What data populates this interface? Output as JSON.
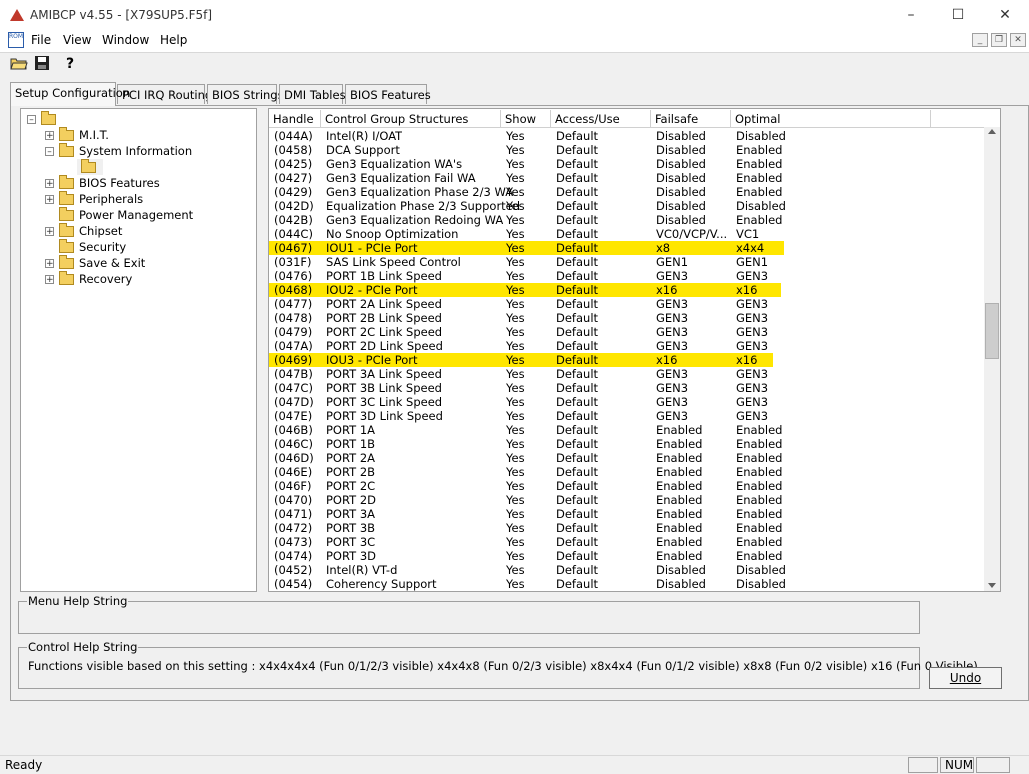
{
  "window": {
    "title": "AMIBCP v4.55 - [X79SUP5.F5f]",
    "minimize_icon": "minimize-icon",
    "maximize_icon": "maximize-icon",
    "close_icon": "close-icon"
  },
  "menu": {
    "doc_icon_text": "ROM",
    "items": [
      "File",
      "View",
      "Window",
      "Help"
    ]
  },
  "toolbar": {
    "buttons": [
      "open-folder-icon",
      "save-disk-icon",
      "help-icon"
    ]
  },
  "tabs": [
    "Setup Configuration",
    "PCI IRQ Routing",
    "BIOS Strings",
    "DMI Tables",
    "BIOS Features"
  ],
  "active_tab": "Setup Configuration",
  "tree": {
    "nodes": [
      {
        "label": "",
        "depth": 0,
        "expander": "minus"
      },
      {
        "label": "M.I.T.",
        "depth": 1,
        "expander": "plus"
      },
      {
        "label": "System Information",
        "depth": 1,
        "expander": "minus"
      },
      {
        "label": "",
        "depth": 2,
        "expander": "none",
        "selected": true
      },
      {
        "label": "BIOS Features",
        "depth": 1,
        "expander": "plus"
      },
      {
        "label": "Peripherals",
        "depth": 1,
        "expander": "plus"
      },
      {
        "label": "Power Management",
        "depth": 1,
        "expander": "none"
      },
      {
        "label": "Chipset",
        "depth": 1,
        "expander": "plus"
      },
      {
        "label": "Security",
        "depth": 1,
        "expander": "none"
      },
      {
        "label": "Save & Exit",
        "depth": 1,
        "expander": "plus"
      },
      {
        "label": "Recovery",
        "depth": 1,
        "expander": "plus"
      }
    ]
  },
  "table": {
    "columns": [
      "Handle",
      "Control Group Structures",
      "Show",
      "Access/Use",
      "Failsafe",
      "Optimal"
    ],
    "highlight_color": "#ffe600",
    "rows": [
      {
        "handle": "(044A)",
        "name": "Intel(R) I/OAT",
        "show": "Yes",
        "access": "Default",
        "failsafe": "Disabled",
        "optimal": "Disabled",
        "hl": false
      },
      {
        "handle": "(0458)",
        "name": "DCA Support",
        "show": "Yes",
        "access": "Default",
        "failsafe": "Disabled",
        "optimal": "Enabled",
        "hl": false
      },
      {
        "handle": "(0425)",
        "name": "Gen3 Equalization WA's",
        "show": "Yes",
        "access": "Default",
        "failsafe": "Disabled",
        "optimal": "Enabled",
        "hl": false
      },
      {
        "handle": "(0427)",
        "name": "Gen3 Equalization Fail WA",
        "show": "Yes",
        "access": "Default",
        "failsafe": "Disabled",
        "optimal": "Enabled",
        "hl": false
      },
      {
        "handle": "(0429)",
        "name": "Gen3 Equalization Phase 2/3 WA",
        "show": "Yes",
        "access": "Default",
        "failsafe": "Disabled",
        "optimal": "Enabled",
        "hl": false
      },
      {
        "handle": "(042D)",
        "name": "Equalization Phase 2/3 Supported",
        "show": "Yes",
        "access": "Default",
        "failsafe": "Disabled",
        "optimal": "Disabled",
        "hl": false
      },
      {
        "handle": "(042B)",
        "name": "Gen3 Equalization Redoing WA",
        "show": "Yes",
        "access": "Default",
        "failsafe": "Disabled",
        "optimal": "Enabled",
        "hl": false
      },
      {
        "handle": "(044C)",
        "name": "No Snoop Optimization",
        "show": "Yes",
        "access": "Default",
        "failsafe": "VC0/VCP/V...",
        "optimal": "VC1",
        "hl": false
      },
      {
        "handle": "(0467)",
        "name": "IOU1 - PCIe Port",
        "show": "Yes",
        "access": "Default",
        "failsafe": "x8",
        "optimal": "x4x4",
        "hl": true
      },
      {
        "handle": "(031F)",
        "name": "SAS Link Speed Control",
        "show": "Yes",
        "access": "Default",
        "failsafe": "GEN1",
        "optimal": "GEN1",
        "hl": false
      },
      {
        "handle": "(0476)",
        "name": "PORT 1B Link Speed",
        "show": "Yes",
        "access": "Default",
        "failsafe": "GEN3",
        "optimal": "GEN3",
        "hl": false
      },
      {
        "handle": "(0468)",
        "name": "IOU2 - PCIe Port",
        "show": "Yes",
        "access": "Default",
        "failsafe": "x16",
        "optimal": "x16",
        "hl": true
      },
      {
        "handle": "(0477)",
        "name": "PORT 2A Link Speed",
        "show": "Yes",
        "access": "Default",
        "failsafe": "GEN3",
        "optimal": "GEN3",
        "hl": false
      },
      {
        "handle": "(0478)",
        "name": "PORT 2B Link Speed",
        "show": "Yes",
        "access": "Default",
        "failsafe": "GEN3",
        "optimal": "GEN3",
        "hl": false
      },
      {
        "handle": "(0479)",
        "name": "PORT 2C Link Speed",
        "show": "Yes",
        "access": "Default",
        "failsafe": "GEN3",
        "optimal": "GEN3",
        "hl": false
      },
      {
        "handle": "(047A)",
        "name": "PORT 2D Link Speed",
        "show": "Yes",
        "access": "Default",
        "failsafe": "GEN3",
        "optimal": "GEN3",
        "hl": false
      },
      {
        "handle": "(0469)",
        "name": "IOU3 - PCIe Port",
        "show": "Yes",
        "access": "Default",
        "failsafe": "x16",
        "optimal": "x16",
        "hl": true
      },
      {
        "handle": "(047B)",
        "name": "PORT 3A Link Speed",
        "show": "Yes",
        "access": "Default",
        "failsafe": "GEN3",
        "optimal": "GEN3",
        "hl": false
      },
      {
        "handle": "(047C)",
        "name": "PORT 3B Link Speed",
        "show": "Yes",
        "access": "Default",
        "failsafe": "GEN3",
        "optimal": "GEN3",
        "hl": false
      },
      {
        "handle": "(047D)",
        "name": "PORT 3C Link Speed",
        "show": "Yes",
        "access": "Default",
        "failsafe": "GEN3",
        "optimal": "GEN3",
        "hl": false
      },
      {
        "handle": "(047E)",
        "name": "PORT 3D Link Speed",
        "show": "Yes",
        "access": "Default",
        "failsafe": "GEN3",
        "optimal": "GEN3",
        "hl": false
      },
      {
        "handle": "(046B)",
        "name": "PORT 1A",
        "show": "Yes",
        "access": "Default",
        "failsafe": "Enabled",
        "optimal": "Enabled",
        "hl": false
      },
      {
        "handle": "(046C)",
        "name": "PORT 1B",
        "show": "Yes",
        "access": "Default",
        "failsafe": "Enabled",
        "optimal": "Enabled",
        "hl": false
      },
      {
        "handle": "(046D)",
        "name": "PORT 2A",
        "show": "Yes",
        "access": "Default",
        "failsafe": "Enabled",
        "optimal": "Enabled",
        "hl": false
      },
      {
        "handle": "(046E)",
        "name": "PORT 2B",
        "show": "Yes",
        "access": "Default",
        "failsafe": "Enabled",
        "optimal": "Enabled",
        "hl": false
      },
      {
        "handle": "(046F)",
        "name": "PORT 2C",
        "show": "Yes",
        "access": "Default",
        "failsafe": "Enabled",
        "optimal": "Enabled",
        "hl": false
      },
      {
        "handle": "(0470)",
        "name": "PORT 2D",
        "show": "Yes",
        "access": "Default",
        "failsafe": "Enabled",
        "optimal": "Enabled",
        "hl": false
      },
      {
        "handle": "(0471)",
        "name": "PORT 3A",
        "show": "Yes",
        "access": "Default",
        "failsafe": "Enabled",
        "optimal": "Enabled",
        "hl": false
      },
      {
        "handle": "(0472)",
        "name": "PORT 3B",
        "show": "Yes",
        "access": "Default",
        "failsafe": "Enabled",
        "optimal": "Enabled",
        "hl": false
      },
      {
        "handle": "(0473)",
        "name": "PORT 3C",
        "show": "Yes",
        "access": "Default",
        "failsafe": "Enabled",
        "optimal": "Enabled",
        "hl": false
      },
      {
        "handle": "(0474)",
        "name": "PORT 3D",
        "show": "Yes",
        "access": "Default",
        "failsafe": "Enabled",
        "optimal": "Enabled",
        "hl": false
      },
      {
        "handle": "(0452)",
        "name": "Intel(R) VT-d",
        "show": "Yes",
        "access": "Default",
        "failsafe": "Disabled",
        "optimal": "Disabled",
        "hl": false
      },
      {
        "handle": "(0454)",
        "name": "Coherency Support",
        "show": "Yes",
        "access": "Default",
        "failsafe": "Disabled",
        "optimal": "Disabled",
        "hl": false
      }
    ]
  },
  "help": {
    "menu_label": "Menu Help String",
    "menu_text": "",
    "control_label": "Control Help String",
    "control_text": "Functions visible based on this setting : x4x4x4x4 (Fun 0/1/2/3 visible) x4x4x8 (Fun 0/2/3 visible) x8x4x4 (Fun 0/1/2 visible) x8x8 (Fun 0/2 visible) x16 (Fun 0 Visible)"
  },
  "undo_label": "Undo",
  "status": {
    "text": "Ready",
    "panes": [
      "",
      "NUM",
      ""
    ]
  }
}
